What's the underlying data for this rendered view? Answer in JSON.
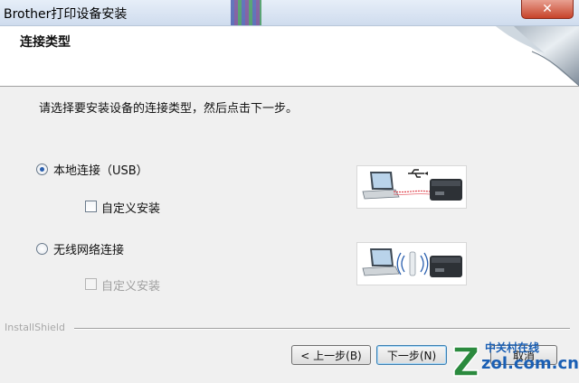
{
  "window": {
    "title": "Brother打印设备安装",
    "close_label": "✕"
  },
  "header": {
    "title": "连接类型"
  },
  "instruction": "请选择要安装设备的连接类型，然后点击下一步。",
  "options": [
    {
      "label": "本地连接（USB）",
      "selected": true,
      "sub": {
        "label": "自定义安装",
        "checked": false,
        "enabled": true
      }
    },
    {
      "label": "无线网络连接",
      "selected": false,
      "sub": {
        "label": "自定义安装",
        "checked": false,
        "enabled": false
      }
    }
  ],
  "footer": {
    "brand": "InstallShield",
    "back_label": "< 上一步(B)",
    "next_label": "下一步(N)",
    "cancel_label": "取消"
  },
  "watermark": {
    "line1": "中关村在线",
    "line2": "zol.com.cn"
  },
  "colors": {
    "accent": "#2a5fae",
    "usb_cable": "#e0404a",
    "watermark": "#1a5fb4"
  }
}
